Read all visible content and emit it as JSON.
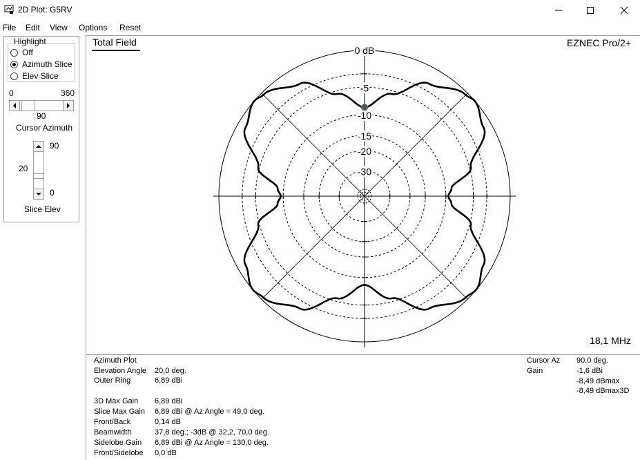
{
  "window": {
    "title": "2D Plot: G5RV"
  },
  "menu": [
    "File",
    "Edit",
    "View",
    "Options",
    "Reset"
  ],
  "highlight": {
    "group_label": "Highlight",
    "options": [
      "Off",
      "Azimuth Slice",
      "Elev Slice"
    ],
    "selected": "Azimuth Slice"
  },
  "azimuth_control": {
    "min": "0",
    "max": "360",
    "value": "90",
    "label": "Cursor Azimuth"
  },
  "elev_control": {
    "max": "90",
    "value": "20",
    "min": "0",
    "label": "Slice Elev"
  },
  "plot": {
    "title": "Total Field",
    "brand": "EZNEC Pro/2+",
    "frequency": "18,1 MHz",
    "ring_labels": [
      "0 dB",
      "-5",
      "-10",
      "-15",
      "-20",
      "-30"
    ]
  },
  "chart_data": {
    "type": "polar",
    "title": "Total Field",
    "radial_scale": "dB relative to outer ring",
    "outer_ring_dBi": 6.89,
    "ring_labels_dB": [
      0,
      -5,
      -10,
      -15,
      -20,
      -30
    ],
    "series": [
      {
        "azimuth_deg": [
          0,
          15,
          30,
          45,
          49,
          60,
          75,
          85,
          90,
          95,
          105,
          120,
          130,
          135,
          150,
          165,
          180
        ],
        "gain_dB": [
          -8.5,
          -5.5,
          -2.0,
          -0.3,
          0.0,
          -1.0,
          -4.8,
          -8.8,
          -9.5,
          -8.8,
          -4.8,
          -1.0,
          0.0,
          -0.3,
          -2.0,
          -5.5,
          -8.5
        ]
      }
    ],
    "symmetry": "mirror about 0-180 axis",
    "cursor_azimuth_deg": 90,
    "cursor_gain_dB": -8.49
  },
  "info": {
    "left": [
      {
        "label": "Azimuth Plot",
        "value": ""
      },
      {
        "label": "Elevation Angle",
        "value": "20,0 deg."
      },
      {
        "label": "Outer Ring",
        "value": "6,89 dBi"
      },
      {
        "label": "3D Max Gain",
        "value": "6,89 dBi"
      },
      {
        "label": "Slice Max Gain",
        "value": "6,89 dBi @ Az Angle = 49,0 deg."
      },
      {
        "label": "Front/Back",
        "value": "0,14 dB"
      },
      {
        "label": "Beamwidth",
        "value": "37,8 deg.; -3dB @ 32,2, 70,0 deg."
      },
      {
        "label": "Sidelobe Gain",
        "value": "6,89 dBi @ Az Angle = 130,0 deg."
      },
      {
        "label": "Front/Sidelobe",
        "value": "0,0 dB"
      }
    ],
    "right": {
      "cursor_az_label": "Cursor Az",
      "cursor_az_value": "90,0 deg.",
      "gain_label": "Gain",
      "gain_values": [
        "-1,6 dBi",
        "-8,49 dBmax",
        "-8,49 dBmax3D"
      ]
    }
  }
}
